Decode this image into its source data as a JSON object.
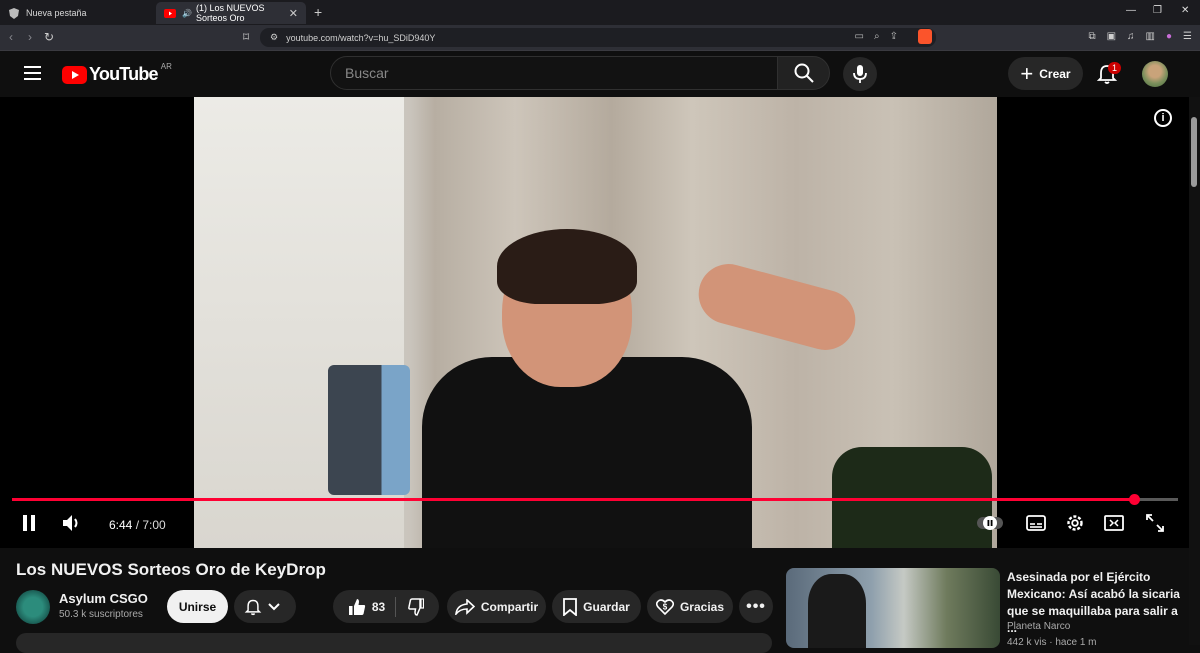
{
  "browser": {
    "tabs": [
      {
        "label": "Nueva pestaña"
      },
      {
        "label": "(1) Los NUEVOS Sorteos Oro"
      }
    ],
    "url": "youtube.com/watch?v=hu_SDiD940Y"
  },
  "header": {
    "logo_text": "YouTube",
    "country_code": "AR",
    "search_placeholder": "Buscar",
    "create_label": "Crear",
    "notification_count": "1"
  },
  "player": {
    "current_time": "6:44",
    "separator": " / ",
    "duration": "7:00",
    "progress_fraction": 0.962
  },
  "video": {
    "title": "Los NUEVOS Sorteos Oro de KeyDrop",
    "channel_name": "Asylum CSGO",
    "subscribers": "50.3 k suscriptores",
    "join_label": "Unirse",
    "like_count": "83",
    "share_label": "Compartir",
    "save_label": "Guardar",
    "thanks_label": "Gracias"
  },
  "recommendation": {
    "title": "Asesinada por el Ejército Mexicano: Así acabó la sicaria que se maquillaba para salir a ...",
    "channel": "Planeta Narco",
    "meta": "442 k vis · hace 1 m"
  },
  "colors": {
    "brand_red": "#ff0000",
    "progress_red": "#ff0033",
    "background": "#0f0f0f"
  }
}
